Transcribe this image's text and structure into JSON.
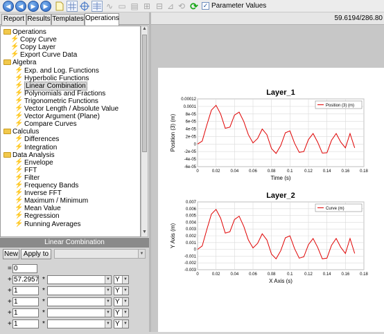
{
  "toolbar": {
    "icons": [
      "back-icon",
      "back-icon",
      "forward-icon",
      "forward-icon",
      "new-document-icon",
      "grid-icon",
      "crosshair-icon",
      "table-icon",
      "wave-icon",
      "layout-icon",
      "layout-icon",
      "layout-icon",
      "layout-icon",
      "plot-icon",
      "refresh-icon",
      "refresh-icon",
      "green-refresh-icon"
    ],
    "parameter_values_label": "Parameter Values",
    "parameter_values_checked": true
  },
  "tabs": [
    "Report",
    "Results",
    "Templates",
    "Operations"
  ],
  "active_tab": "Operations",
  "coordinate_readout": "59.6194/286.80",
  "tree": [
    {
      "label": "Operations",
      "type": "folder",
      "level": 0
    },
    {
      "label": "Copy Curve",
      "type": "function",
      "level": 1
    },
    {
      "label": "Copy Layer",
      "type": "function",
      "level": 1
    },
    {
      "label": "Export Curve Data",
      "type": "function",
      "level": 1
    },
    {
      "label": "Algebra",
      "type": "folder",
      "level": 0
    },
    {
      "label": "Exp. and Log. Functions",
      "type": "function",
      "level": 2
    },
    {
      "label": "Hyperbolic Functions",
      "type": "function",
      "level": 2
    },
    {
      "label": "Linear Combination",
      "type": "function",
      "level": 2,
      "selected": true
    },
    {
      "label": "Polynomials and Fractions",
      "type": "function",
      "level": 2
    },
    {
      "label": "Trigonometric Functions",
      "type": "function",
      "level": 2
    },
    {
      "label": "Vector Length / Absolute Value",
      "type": "function",
      "level": 2
    },
    {
      "label": "Vector Argument (Plane)",
      "type": "function",
      "level": 2
    },
    {
      "label": "Compare Curves",
      "type": "function",
      "level": 2
    },
    {
      "label": "Calculus",
      "type": "folder",
      "level": 0
    },
    {
      "label": "Differences",
      "type": "function",
      "level": 2
    },
    {
      "label": "Integration",
      "type": "function",
      "level": 2
    },
    {
      "label": "Data Analysis",
      "type": "folder",
      "level": 0
    },
    {
      "label": "Envelope",
      "type": "function",
      "level": 2
    },
    {
      "label": "FFT",
      "type": "function",
      "level": 2
    },
    {
      "label": "Filter",
      "type": "function",
      "level": 2
    },
    {
      "label": "Frequency Bands",
      "type": "function",
      "level": 2
    },
    {
      "label": "Inverse FFT",
      "type": "function",
      "level": 2
    },
    {
      "label": "Maximum / Minimum",
      "type": "function",
      "level": 2
    },
    {
      "label": "Mean Value",
      "type": "function",
      "level": 2
    },
    {
      "label": "Regression",
      "type": "function",
      "level": 2
    },
    {
      "label": "Running Averages",
      "type": "function",
      "level": 2
    }
  ],
  "linear_combination": {
    "header": "Linear Combination",
    "new_button": "New",
    "apply_button": "Apply to",
    "apply_target": "",
    "equals": "=",
    "constant": "0",
    "rows": [
      {
        "sign": "+",
        "factor": "57.29577",
        "op": "*",
        "curve": "",
        "axis": "Y"
      },
      {
        "sign": "+",
        "factor": "1",
        "op": "*",
        "curve": "",
        "axis": "Y"
      },
      {
        "sign": "+",
        "factor": "1",
        "op": "*",
        "curve": "",
        "axis": "Y"
      },
      {
        "sign": "+",
        "factor": "1",
        "op": "*",
        "curve": "",
        "axis": "Y"
      },
      {
        "sign": "+",
        "factor": "1",
        "op": "*",
        "curve": "",
        "axis": "Y"
      }
    ]
  },
  "chart_data": [
    {
      "type": "line",
      "title": "Layer_1",
      "xlabel": "Time (s)",
      "ylabel": "Position (3) (m)",
      "xlim": [
        0,
        0.18
      ],
      "ylim": [
        -6e-05,
        0.00012
      ],
      "xticks": [
        "0",
        "0.02",
        "0.04",
        "0.06",
        "0.08",
        "0.1",
        "0.12",
        "0.14",
        "0.16",
        "0.18"
      ],
      "yticks": [
        "-6e-05",
        "-4e-05",
        "-2e-05",
        "0",
        "2e-05",
        "4e-05",
        "6e-05",
        "8e-05",
        "0.0001",
        "0.00012"
      ],
      "grid": true,
      "legend_position": "top-right",
      "series": [
        {
          "name": "Position (3) (m)",
          "color": "#e00000",
          "x": [
            0,
            0.005,
            0.01,
            0.015,
            0.02,
            0.025,
            0.03,
            0.035,
            0.04,
            0.045,
            0.05,
            0.055,
            0.06,
            0.065,
            0.07,
            0.075,
            0.08,
            0.085,
            0.09,
            0.095,
            0.1,
            0.105,
            0.11,
            0.115,
            0.12,
            0.125,
            0.13,
            0.135,
            0.14,
            0.145,
            0.15,
            0.155,
            0.16,
            0.165,
            0.17
          ],
          "y": [
            0.0,
            8e-06,
            5e-05,
            9e-05,
            0.000103,
            8e-05,
            4.2e-05,
            4.5e-05,
            7.7e-05,
            8.5e-05,
            6e-05,
            2.5e-05,
            3e-06,
            1.5e-05,
            4e-05,
            2.5e-05,
            -1.2e-05,
            -2.5e-05,
            -4e-06,
            3e-05,
            3.5e-05,
            2e-06,
            -2.2e-05,
            -2e-05,
            1.2e-05,
            2.8e-05,
            5e-06,
            -2.4e-05,
            -2.3e-05,
            1e-05,
            2.8e-05,
            5e-06,
            -1e-05,
            2.8e-05,
            -1e-05
          ]
        }
      ]
    },
    {
      "type": "line",
      "title": "Layer_2",
      "xlabel": "X Axis (s)",
      "ylabel": "Y Axis (m)",
      "xlim": [
        0,
        0.18
      ],
      "ylim": [
        -0.003,
        0.007
      ],
      "xticks": [
        "0",
        "0.02",
        "0.04",
        "0.06",
        "0.08",
        "0.1",
        "0.12",
        "0.14",
        "0.16",
        "0.18"
      ],
      "yticks": [
        "-0.003",
        "-0.002",
        "-0.001",
        "0",
        "0.001",
        "0.002",
        "0.003",
        "0.004",
        "0.005",
        "0.006",
        "0.007"
      ],
      "grid": true,
      "legend_position": "top-right",
      "series": [
        {
          "name": "Curve (m)",
          "color": "#e00000",
          "x": [
            0,
            0.005,
            0.01,
            0.015,
            0.02,
            0.025,
            0.03,
            0.035,
            0.04,
            0.045,
            0.05,
            0.055,
            0.06,
            0.065,
            0.07,
            0.075,
            0.08,
            0.085,
            0.09,
            0.095,
            0.1,
            0.105,
            0.11,
            0.115,
            0.12,
            0.125,
            0.13,
            0.135,
            0.14,
            0.145,
            0.15,
            0.155,
            0.16,
            0.165,
            0.17
          ],
          "y": [
            0.0,
            0.0005,
            0.0029,
            0.0052,
            0.0059,
            0.0046,
            0.0024,
            0.0026,
            0.0044,
            0.0049,
            0.0034,
            0.0014,
            0.0002,
            0.0009,
            0.0023,
            0.0014,
            -0.0007,
            -0.0014,
            -0.0002,
            0.0017,
            0.002,
            0.0001,
            -0.0013,
            -0.0011,
            0.0007,
            0.0016,
            0.0003,
            -0.0014,
            -0.0013,
            0.0006,
            0.0016,
            0.0003,
            -0.0006,
            0.0016,
            -0.0006
          ]
        }
      ]
    }
  ]
}
